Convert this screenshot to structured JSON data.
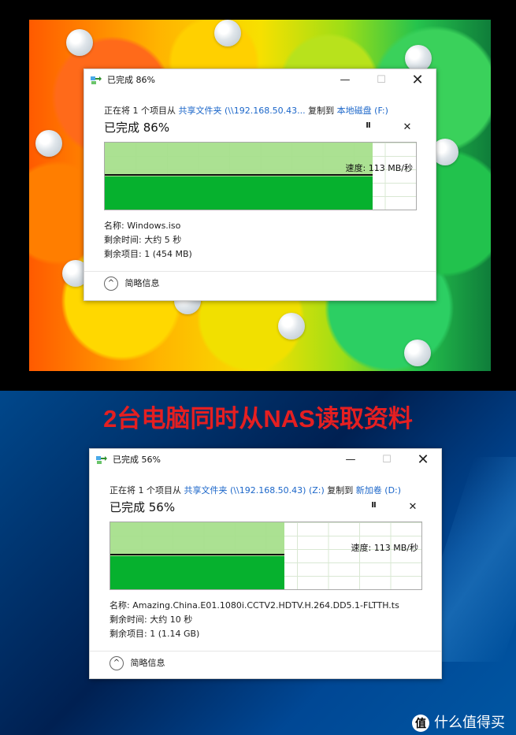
{
  "headline": "2台电脑同时从NAS读取资料",
  "watermark": "什么值得买",
  "dialogs": [
    {
      "title": "已完成 86%",
      "line_prefix": "正在将 1 个项目从",
      "source_name": "共享文件夹 (\\\\192.168.50.43...",
      "copy_to": "复制到",
      "destination": "本地磁盘 (F:)",
      "progress_label": "已完成 86%",
      "progress_percent": 86,
      "speed_label": "速度: 113 MB/秒",
      "speed_fill_percent": 86,
      "name_label": "名称: Windows.iso",
      "remaining_time": "剩余时间: 大约 5 秒",
      "remaining_items": "剩余项目: 1 (454 MB)",
      "footer_label": "简略信息"
    },
    {
      "title": "已完成 56%",
      "line_prefix": "正在将 1 个项目从",
      "source_name": "共享文件夹 (\\\\192.168.50.43) (Z:)",
      "copy_to": "复制到",
      "destination": "新加卷 (D:)",
      "progress_label": "已完成 56%",
      "progress_percent": 56,
      "speed_label": "速度: 113 MB/秒",
      "speed_fill_percent": 56,
      "name_label": "名称: Amazing.China.E01.1080i.CCTV2.HDTV.H.264.DD5.1-FLTTH.ts",
      "remaining_time": "剩余时间: 大约 10 秒",
      "remaining_items": "剩余项目: 1 (1.14 GB)",
      "footer_label": "简略信息"
    }
  ]
}
